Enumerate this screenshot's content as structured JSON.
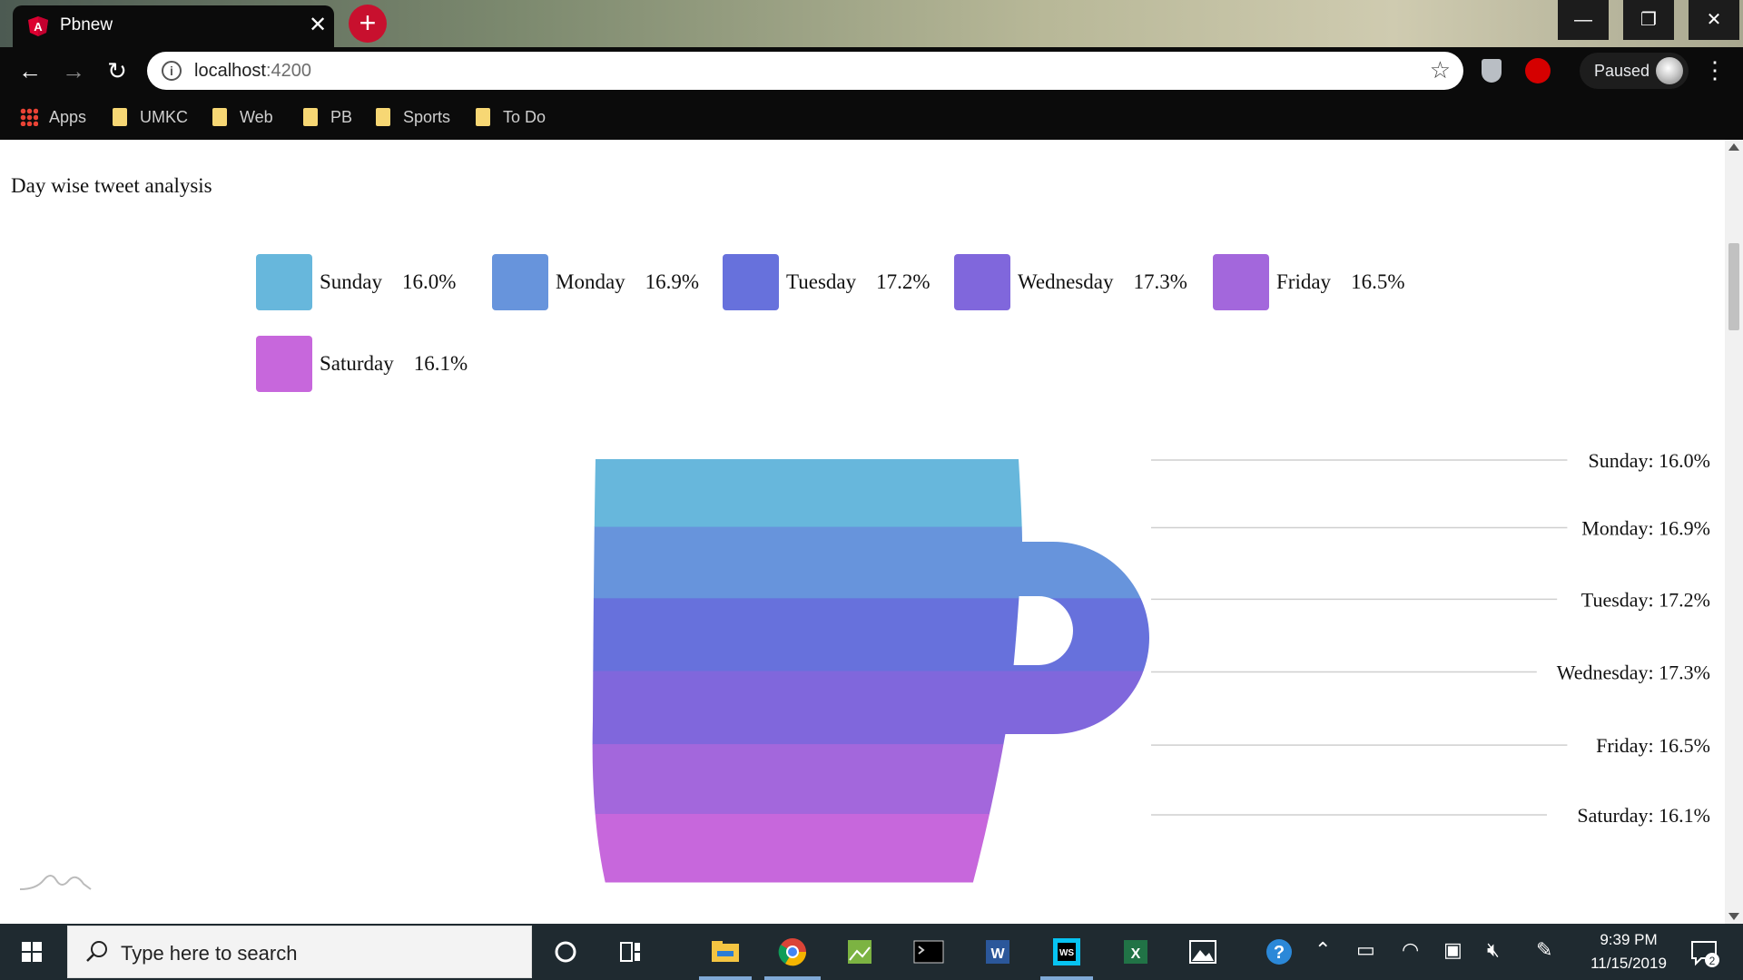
{
  "browser": {
    "tab_title": "Pbnew",
    "tab_close": "✕",
    "new_tab": "+",
    "url_host": "localhost",
    "url_port": ":4200",
    "profile_status": "Paused",
    "window_controls": {
      "minimize": "—",
      "maximize": "❐",
      "close": "✕"
    }
  },
  "bookmarks": [
    {
      "label": "Apps",
      "icon": "apps-grid-icon"
    },
    {
      "label": "UMKC",
      "icon": "folder-icon"
    },
    {
      "label": "Web",
      "icon": "folder-icon"
    },
    {
      "label": "PB",
      "icon": "folder-icon"
    },
    {
      "label": "Sports",
      "icon": "folder-icon"
    },
    {
      "label": "To Do",
      "icon": "folder-icon"
    }
  ],
  "page": {
    "title": "Day wise tweet analysis"
  },
  "chart_data": {
    "type": "pie",
    "shape": "cup",
    "categories": [
      "Sunday",
      "Monday",
      "Tuesday",
      "Wednesday",
      "Friday",
      "Saturday"
    ],
    "values": [
      16.0,
      16.9,
      17.2,
      17.3,
      16.5,
      16.1
    ],
    "value_labels": [
      "16.0%",
      "16.9%",
      "17.2%",
      "17.3%",
      "16.5%",
      "16.1%"
    ],
    "colors": [
      "#67b7dc",
      "#6794dc",
      "#6771dc",
      "#8067dc",
      "#a367dc",
      "#c767dc"
    ],
    "slice_labels": [
      "Sunday: 16.0%",
      "Monday: 16.9%",
      "Tuesday: 17.2%",
      "Wednesday: 17.3%",
      "Friday: 16.5%",
      "Saturday: 16.1%"
    ],
    "legend_position": "top"
  },
  "taskbar": {
    "search_placeholder": "Type here to search",
    "time": "9:39 PM",
    "date": "11/15/2019",
    "notification_count": "2"
  }
}
